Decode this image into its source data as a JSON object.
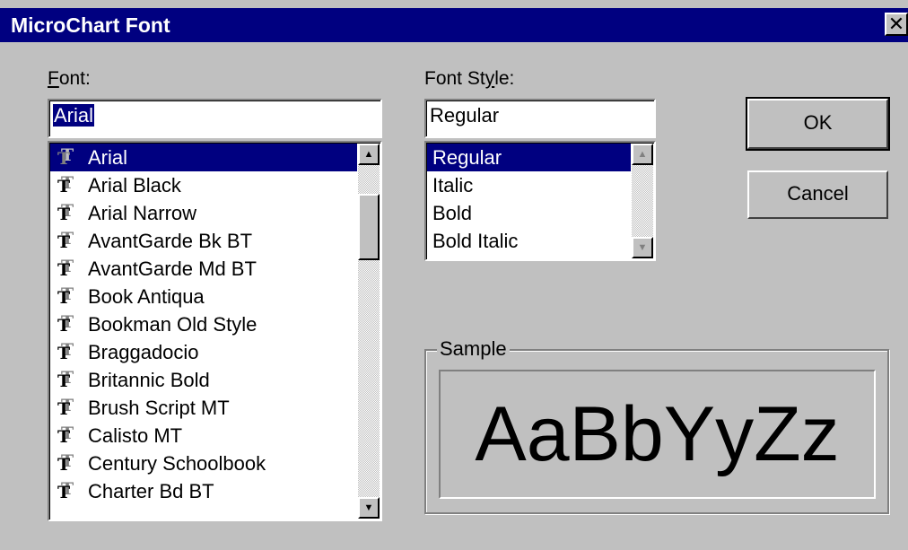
{
  "window": {
    "title": "MicroChart Font",
    "close_glyph": "✕"
  },
  "font": {
    "label_accel": "F",
    "label_rest": "ont:",
    "value": "Arial",
    "items": [
      {
        "label": "Arial",
        "icon": "truetype-icon"
      },
      {
        "label": "Arial Black",
        "icon": "truetype-icon"
      },
      {
        "label": "Arial Narrow",
        "icon": "truetype-icon"
      },
      {
        "label": "AvantGarde Bk BT",
        "icon": "truetype-icon"
      },
      {
        "label": "AvantGarde Md BT",
        "icon": "truetype-icon"
      },
      {
        "label": "Book Antiqua",
        "icon": "truetype-icon"
      },
      {
        "label": "Bookman Old Style",
        "icon": "truetype-icon"
      },
      {
        "label": "Braggadocio",
        "icon": "truetype-icon"
      },
      {
        "label": "Britannic Bold",
        "icon": "truetype-icon"
      },
      {
        "label": "Brush Script MT",
        "icon": "truetype-icon"
      },
      {
        "label": "Calisto MT",
        "icon": "truetype-icon"
      },
      {
        "label": "Century Schoolbook",
        "icon": "truetype-icon"
      },
      {
        "label": "Charter Bd BT",
        "icon": "truetype-icon"
      }
    ],
    "selected": "Arial"
  },
  "style": {
    "label_pre": "Font St",
    "label_accel": "y",
    "label_rest": "le:",
    "value": "Regular",
    "items": [
      "Regular",
      "Italic",
      "Bold",
      "Bold Italic"
    ],
    "selected": "Regular"
  },
  "buttons": {
    "ok": "OK",
    "cancel": "Cancel"
  },
  "sample": {
    "label": "Sample",
    "text": "AaBbYyZz"
  },
  "colors": {
    "face": "#c0c0c0",
    "titlebar": "#000080",
    "selection": "#000080"
  }
}
